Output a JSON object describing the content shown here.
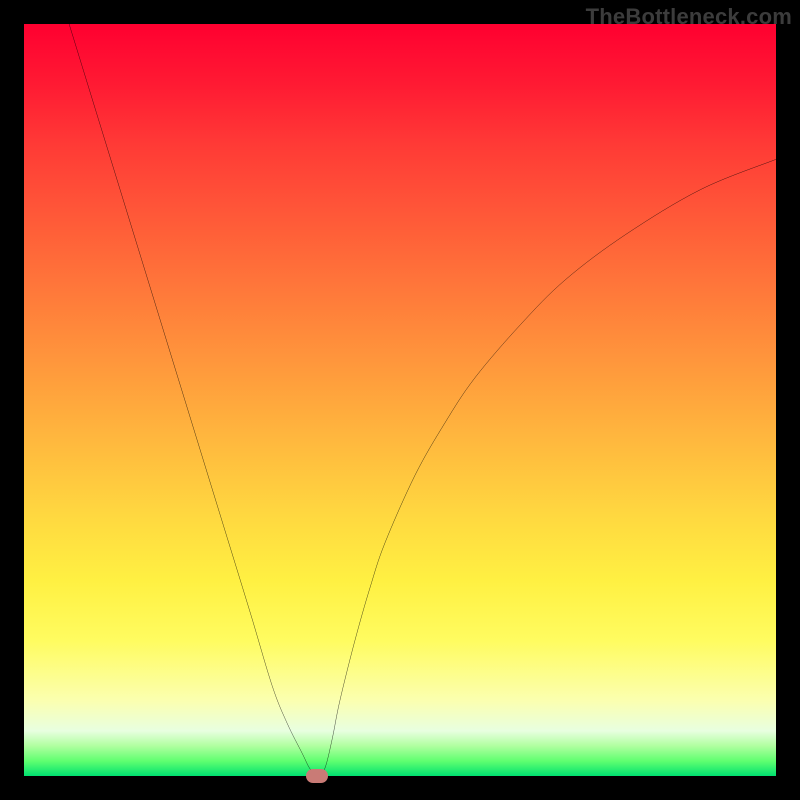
{
  "watermark": "TheBottleneck.com",
  "chart_data": {
    "type": "line",
    "title": "",
    "xlabel": "",
    "ylabel": "",
    "xlim": [
      0,
      100
    ],
    "ylim": [
      0,
      100
    ],
    "grid": false,
    "legend": false,
    "series": [
      {
        "name": "curve",
        "x": [
          6,
          10,
          14,
          18,
          22,
          26,
          30,
          33,
          35,
          37,
          38,
          39,
          40,
          41,
          42,
          44,
          46,
          48,
          52,
          56,
          60,
          66,
          72,
          80,
          90,
          100
        ],
        "y": [
          100,
          87,
          74,
          61,
          48,
          35,
          22,
          12,
          7,
          3,
          1,
          0,
          1,
          5,
          10,
          18,
          25,
          31,
          40,
          47,
          53,
          60,
          66,
          72,
          78,
          82
        ]
      }
    ],
    "marker": {
      "x": 39,
      "y": 0,
      "color": "#c97b76"
    },
    "colors": {
      "curve": "#000000",
      "frame": "#000000",
      "gradient_top": "#ff0030",
      "gradient_bottom": "#00e070"
    }
  }
}
